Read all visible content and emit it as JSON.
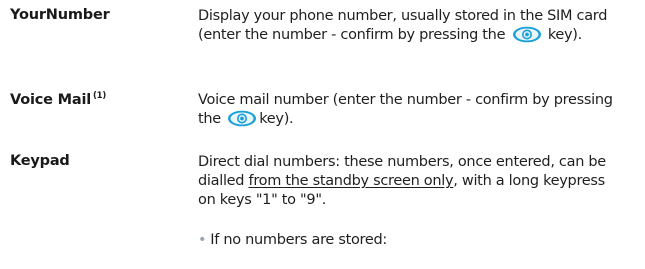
{
  "entries": [
    {
      "term": "YourNumber",
      "desc_before_icon": "Display your phone number, usually stored in the SIM card (enter the number - confirm by pressing the",
      "key_icon": "ok-key-icon",
      "desc_after_icon": "key)."
    },
    {
      "term": "Voice Mail",
      "term_note": "(1)",
      "desc_before_icon": "Voice mail number (enter the number - confirm by pressing the",
      "key_icon": "ok-key-icon",
      "desc_after_icon": "key)."
    },
    {
      "term": "Keypad",
      "desc_before_underline": "Direct dial numbers: these numbers, once entered, can be dialled",
      "desc_underlined": "from the standby screen only",
      "desc_after_underline": ", with a long keypress on keys \"1\" to \"9\"."
    }
  ],
  "bullet": {
    "marker": "•",
    "text": "If no numbers are stored:"
  },
  "colors": {
    "text": "#1f1f1f",
    "key_outer": "#1a9fd8",
    "key_inner": "#e9f6fc",
    "bullet": "#9aa7b6"
  }
}
